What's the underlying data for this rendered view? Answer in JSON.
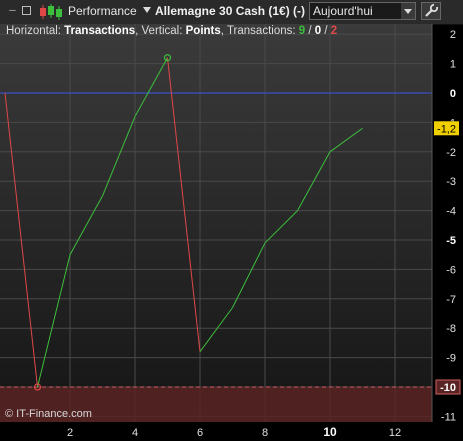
{
  "toolbar": {
    "perf_label": "Performance",
    "instrument": "Allemagne 30 Cash (1€) (-)",
    "period": "Aujourd'hui",
    "icons": [
      "minimize-icon",
      "restore-icon",
      "candlestick-icon",
      "chevron-down-icon",
      "wrench-icon"
    ]
  },
  "header": {
    "prefix": "Horizontal: ",
    "horizontal": "Transactions",
    "mid": ", Vertical: ",
    "vertical": "Points",
    "mid2": ", Transactions: ",
    "wins": "9",
    "sep1": " / ",
    "even": "0",
    "sep2": " / ",
    "losses": "2"
  },
  "colors": {
    "win": "#3cbf3c",
    "loss": "#e04848",
    "zero_line": "#3a50c8",
    "badge": "#f0d000",
    "loss_zone": "#5a2323"
  },
  "copyright": "© IT-Finance.com",
  "chart_data": {
    "type": "line",
    "x": [
      0,
      1,
      2,
      3,
      4,
      5,
      6,
      7,
      8,
      9,
      10,
      11
    ],
    "y": [
      0,
      -10,
      -5.5,
      -3.5,
      -0.8,
      1.2,
      -8.8,
      -7.3,
      -5.1,
      -4.0,
      -2.0,
      -1.2
    ],
    "segment_result": [
      "loss",
      "win",
      "win",
      "win",
      "win",
      "loss",
      "win",
      "win",
      "win",
      "win",
      "win"
    ],
    "markers": [
      {
        "x": 1,
        "y": -10,
        "result": "loss"
      },
      {
        "x": 5,
        "y": 1.2,
        "result": "win"
      }
    ],
    "zero_line": 0,
    "min_line": -10,
    "last_value_label": "-1,2",
    "xlim": [
      0,
      13
    ],
    "ylim": [
      -11,
      2
    ],
    "xticks": [
      2,
      4,
      6,
      8,
      10,
      12
    ],
    "xticks_bold": [
      10
    ],
    "yticks": [
      2,
      1,
      0,
      -1,
      -2,
      -3,
      -4,
      -5,
      -6,
      -7,
      -8,
      -9,
      -10,
      -11
    ],
    "yticks_bold": [
      0,
      -5,
      -10
    ],
    "yticks_boxed": [
      -10
    ],
    "grid": true
  }
}
